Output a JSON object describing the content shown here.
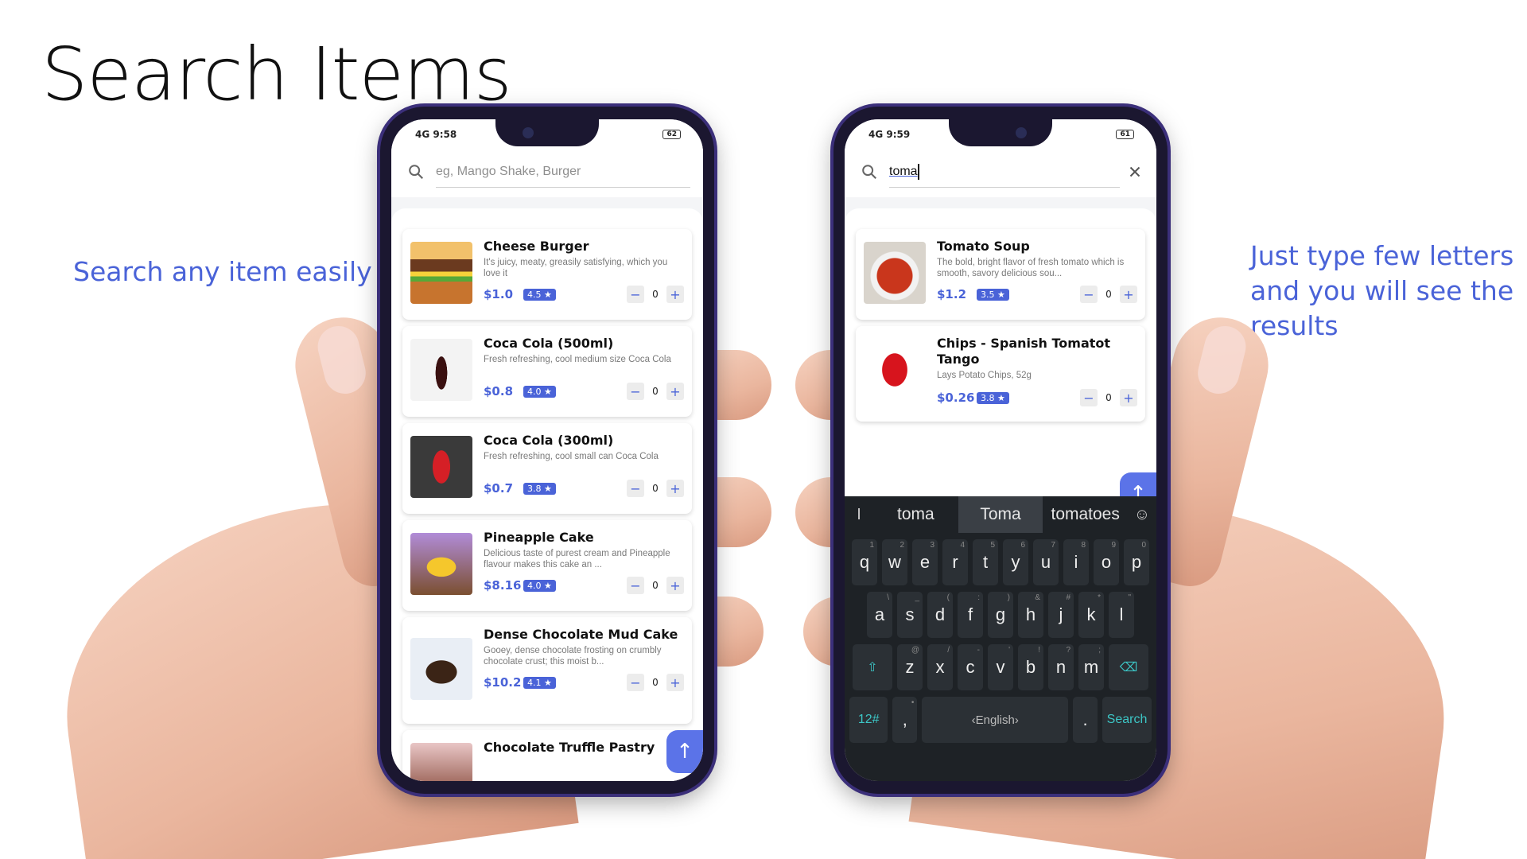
{
  "slide": {
    "title": "Search Items",
    "caption_left": "Search any item easily",
    "caption_right": "Just type few letters and you will see the results"
  },
  "phone_left": {
    "status": {
      "time": "9:58",
      "net": "4G",
      "battery": "62"
    },
    "search": {
      "placeholder": "eg, Mango Shake, Burger",
      "value": ""
    },
    "items": [
      {
        "name": "Cheese Burger",
        "desc": "It's juicy, meaty, greasily satisfying, which you love it",
        "price": "$1.0",
        "rating": "4.5 ★",
        "qty": "0"
      },
      {
        "name": "Coca Cola (500ml)",
        "desc": "Fresh refreshing, cool medium size Coca Cola",
        "price": "$0.8",
        "rating": "4.0 ★",
        "qty": "0"
      },
      {
        "name": "Coca Cola (300ml)",
        "desc": "Fresh refreshing, cool small can Coca Cola",
        "price": "$0.7",
        "rating": "3.8 ★",
        "qty": "0"
      },
      {
        "name": "Pineapple Cake",
        "desc": "Delicious taste of purest cream and Pineapple flavour makes this cake an ...",
        "price": "$8.16",
        "rating": "4.0 ★",
        "qty": "0"
      },
      {
        "name": "Dense Chocolate Mud Cake",
        "desc": "Gooey, dense chocolate frosting on crumbly chocolate crust; this moist b...",
        "price": "$10.2",
        "rating": "4.1 ★",
        "qty": "0"
      },
      {
        "name": "Chocolate Truffle Pastry",
        "desc": "",
        "price": "",
        "rating": "",
        "qty": ""
      }
    ]
  },
  "phone_right": {
    "status": {
      "time": "9:59",
      "net": "4G",
      "battery": "61"
    },
    "search": {
      "placeholder": "",
      "value": "toma"
    },
    "items": [
      {
        "name": "Tomato Soup",
        "desc": "The bold, bright flavor of fresh tomato which is smooth, savory delicious sou...",
        "price": "$1.2",
        "rating": "3.5 ★",
        "qty": "0"
      },
      {
        "name": "Chips - Spanish Tomatot Tango",
        "desc": "Lays Potato Chips, 52g",
        "price": "$0.26",
        "rating": "3.8 ★",
        "qty": "0"
      }
    ],
    "keyboard": {
      "suggestions": [
        "toma",
        "Toma",
        "tomatoes"
      ],
      "row1": [
        [
          "q",
          "1"
        ],
        [
          "w",
          "2"
        ],
        [
          "e",
          "3"
        ],
        [
          "r",
          "4"
        ],
        [
          "t",
          "5"
        ],
        [
          "y",
          "6"
        ],
        [
          "u",
          "7"
        ],
        [
          "i",
          "8"
        ],
        [
          "o",
          "9"
        ],
        [
          "p",
          "0"
        ]
      ],
      "row2": [
        [
          "a",
          "\\"
        ],
        [
          "s",
          "_"
        ],
        [
          "d",
          "("
        ],
        [
          "f",
          ":"
        ],
        [
          "g",
          ")"
        ],
        [
          "h",
          "&"
        ],
        [
          "j",
          "#"
        ],
        [
          "k",
          "*"
        ],
        [
          "l",
          "\""
        ]
      ],
      "row3": [
        [
          "z",
          "@"
        ],
        [
          "x",
          "/"
        ],
        [
          "c",
          "-"
        ],
        [
          "v",
          "'"
        ],
        [
          "b",
          "!"
        ],
        [
          "n",
          "?"
        ],
        [
          "m",
          ";"
        ]
      ],
      "numbers_key": "12#",
      "comma_key": ",",
      "space_label": "English",
      "period_key": ".",
      "action_key": "Search"
    }
  },
  "colors": {
    "accent": "#4a63d8",
    "fab": "#5b73e8",
    "keyboard": "#1e2226"
  },
  "icons": [
    "search-icon",
    "clear-icon",
    "arrow-up-icon",
    "minus-icon",
    "plus-icon",
    "shift-icon",
    "backspace-icon",
    "emoji-icon",
    "mic-icon"
  ]
}
